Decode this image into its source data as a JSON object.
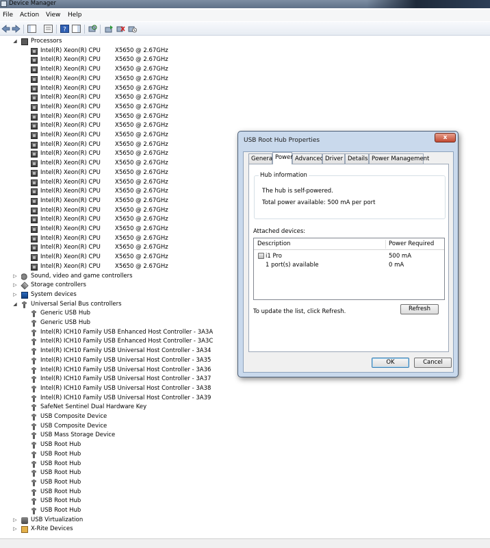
{
  "window": {
    "title": "Device Manager"
  },
  "menu": {
    "items": [
      "File",
      "Action",
      "View",
      "Help"
    ]
  },
  "toolbar": {
    "buttons": [
      "back-icon",
      "forward-icon",
      "show-hide-console-tree-icon",
      "properties-icon",
      "help-icon",
      "show-hide-action-pane-icon",
      "scan-for-hardware-changes-icon",
      "update-driver-icon",
      "uninstall-icon",
      "disable-icon"
    ]
  },
  "tree": {
    "processors_label": "Processors",
    "cpu_name": "Intel(R) Xeon(R) CPU",
    "cpu_model": "X5650  @ 2.67GHz",
    "cpu_count": 24,
    "categories_after": [
      "Sound, video and game controllers",
      "Storage controllers",
      "System devices"
    ],
    "usb_label": "Universal Serial Bus controllers",
    "usb_items": [
      "Generic USB Hub",
      "Generic USB Hub",
      "Intel(R) ICH10 Family USB Enhanced Host Controller - 3A3A",
      "Intel(R) ICH10 Family USB Enhanced Host Controller - 3A3C",
      "Intel(R) ICH10 Family USB Universal Host Controller - 3A34",
      "Intel(R) ICH10 Family USB Universal Host Controller - 3A35",
      "Intel(R) ICH10 Family USB Universal Host Controller - 3A36",
      "Intel(R) ICH10 Family USB Universal Host Controller - 3A37",
      "Intel(R) ICH10 Family USB Universal Host Controller - 3A38",
      "Intel(R) ICH10 Family USB Universal Host Controller - 3A39",
      "SafeNet Sentinel Dual Hardware Key",
      "USB Composite Device",
      "USB Composite Device",
      "USB Mass Storage Device",
      "USB Root Hub",
      "USB Root Hub",
      "USB Root Hub",
      "USB Root Hub",
      "USB Root Hub",
      "USB Root Hub",
      "USB Root Hub",
      "USB Root Hub"
    ],
    "categories_end": [
      "USB Virtualization",
      "X-Rite Devices"
    ]
  },
  "dialog": {
    "title": "USB Root Hub Properties",
    "close_label": "x",
    "tabs": [
      "General",
      "Power",
      "Advanced",
      "Driver",
      "Details",
      "Power Management"
    ],
    "active_tab": "Power",
    "hub_info_title": "Hub information",
    "self_powered_text": "The hub is self-powered.",
    "total_power_text": "Total power available:  500 mA per port",
    "attached_label": "Attached devices:",
    "list_headers": {
      "description": "Description",
      "power": "Power Required"
    },
    "list_rows": [
      {
        "description": "i1 Pro",
        "power": "500 mA"
      },
      {
        "description": "1 port(s) available",
        "power": "0 mA"
      }
    ],
    "refresh_hint": "To update the list, click Refresh.",
    "refresh_label": "Refresh",
    "ok_label": "OK",
    "cancel_label": "Cancel"
  }
}
